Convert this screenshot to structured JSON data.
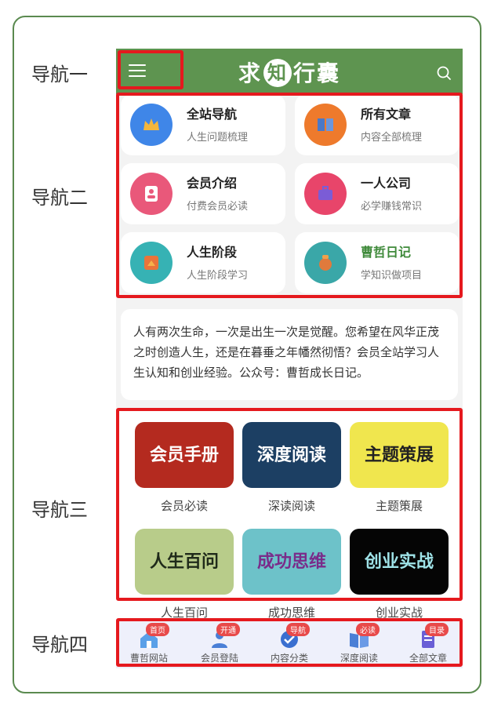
{
  "labels": {
    "nav1": "导航一",
    "nav2": "导航二",
    "nav3": "导航三",
    "nav4": "导航四"
  },
  "header": {
    "brand_a": "求",
    "brand_b": "知",
    "brand_c": "行囊"
  },
  "cards": [
    {
      "title": "全站导航",
      "sub": "人生问题梳理",
      "color": "#3f86e8",
      "icon": "crown-icon"
    },
    {
      "title": "所有文章",
      "sub": "内容全部梳理",
      "color": "#ee7a2c",
      "icon": "book-icon"
    },
    {
      "title": "会员介绍",
      "sub": "付费会员必读",
      "color": "#e9587a",
      "icon": "user-icon"
    },
    {
      "title": "一人公司",
      "sub": "必学赚钱常识",
      "color": "#e8456a",
      "icon": "briefcase-icon"
    },
    {
      "title": "人生阶段",
      "sub": "人生阶段学习",
      "color": "#36b2b4",
      "icon": "stage-icon"
    },
    {
      "title": "曹哲日记",
      "sub": "学知识做项目",
      "color": "#3aa7a8",
      "icon": "diary-icon"
    }
  ],
  "intro": "人有两次生命，一次是出生一次是觉醒。您希望在风华正茂之时创造人生，还是在暮垂之年幡然彻悟？会员全站学习人生认知和创业经验。公众号：曹哲成长日记。",
  "tiles": [
    {
      "label": "会员手册",
      "caption": "会员必读",
      "bg": "#b42a1f",
      "fg": "#ffffff"
    },
    {
      "label": "深度阅读",
      "caption": "深读阅读",
      "bg": "#1c3f63",
      "fg": "#ffffff"
    },
    {
      "label": "主题策展",
      "caption": "主题策展",
      "bg": "#f0e64e",
      "fg": "#222222"
    },
    {
      "label": "人生百问",
      "caption": "人生百问",
      "bg": "#b8cc8a",
      "fg": "#1f2a1a"
    },
    {
      "label": "成功思维",
      "caption": "成功思维",
      "bg": "#6dc2c9",
      "fg": "#7a2c8a"
    },
    {
      "label": "创业实战",
      "caption": "创业实战",
      "bg": "#050505",
      "fg": "#9fe3e8"
    }
  ],
  "tabs": [
    {
      "label": "曹哲网站",
      "badge": "首页",
      "color": "#5aa0e8",
      "icon": "home-icon"
    },
    {
      "label": "会员登陆",
      "badge": "开通",
      "color": "#4a7fd6",
      "icon": "user-login-icon"
    },
    {
      "label": "内容分类",
      "badge": "导航",
      "color": "#3a6fd0",
      "icon": "check-badge-icon"
    },
    {
      "label": "深度阅读",
      "badge": "必读",
      "color": "#4a7fd6",
      "icon": "open-book-icon"
    },
    {
      "label": "全部文章",
      "badge": "目录",
      "color": "#6a5fd6",
      "icon": "document-icon"
    }
  ]
}
